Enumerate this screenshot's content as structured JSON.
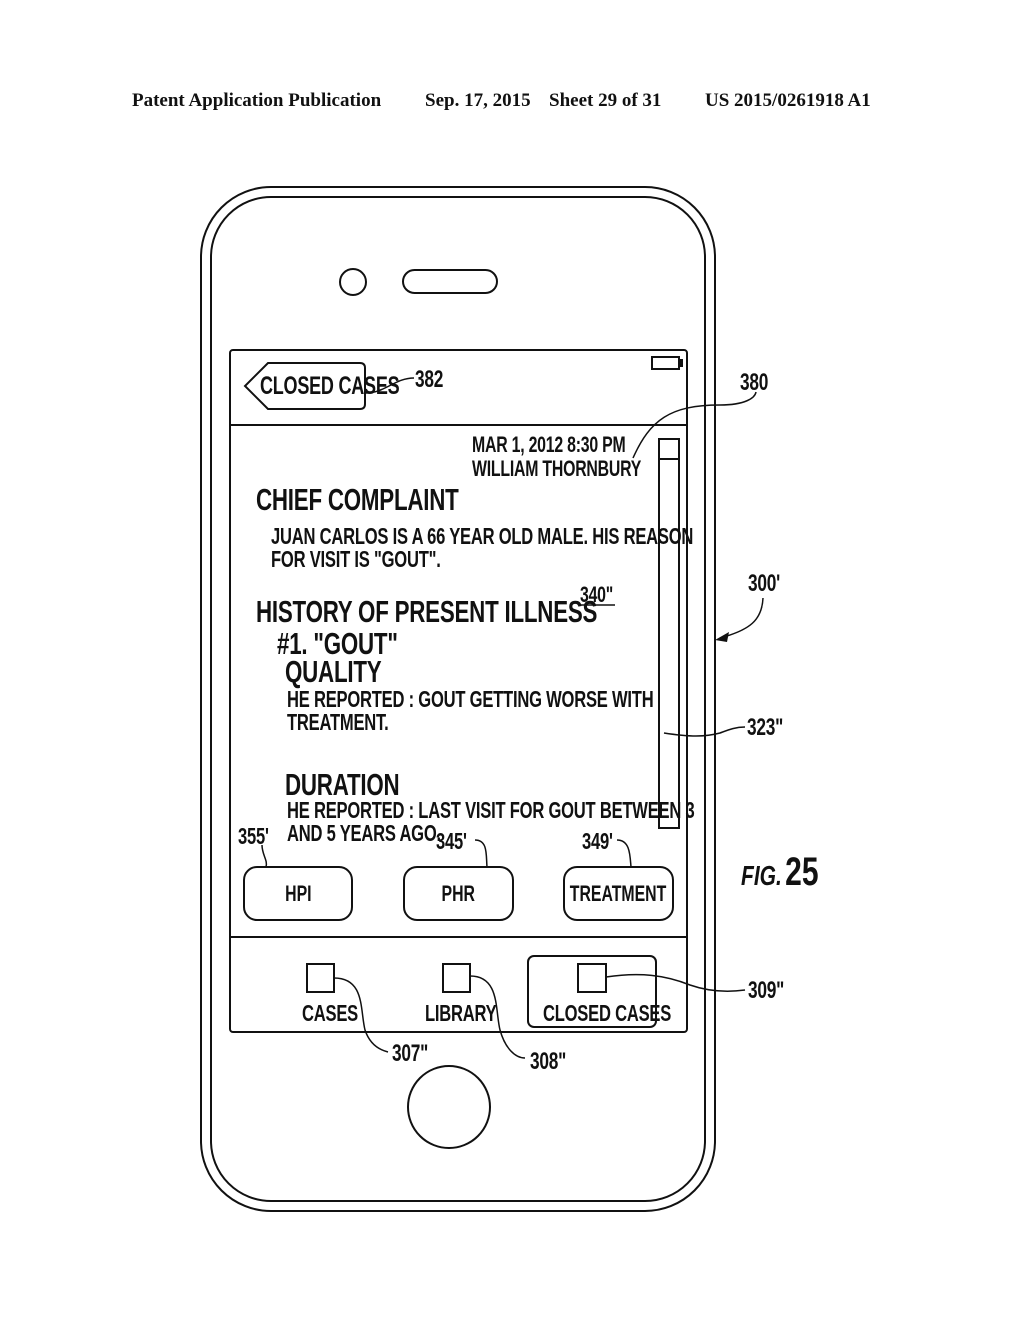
{
  "header": {
    "publication": "Patent Application Publication",
    "date": "Sep. 17, 2015",
    "sheet": "Sheet 29 of 31",
    "number": "US 2015/0261918 A1"
  },
  "figure_label": "FIG. 25",
  "figure_label_prefix": "FIG.",
  "figure_label_number": "25",
  "screen": {
    "back_button_label": "CLOSED CASES",
    "battery_icon": "battery-icon",
    "timestamp": "MAR 1, 2012 8:30 PM",
    "physician": "WILLIAM THORNBURY",
    "sections": {
      "chief_complaint_title": "CHIEF COMPLAINT",
      "chief_complaint_line1": "JUAN CARLOS IS A 66 YEAR OLD MALE. HIS REASON",
      "chief_complaint_line2": "FOR VISIT IS \"GOUT\".",
      "hpi_title": "HISTORY OF PRESENT ILLNESS",
      "hpi_item": "#1.  \"GOUT\"",
      "quality_title": "QUALITY",
      "quality_line1": "HE REPORTED : GOUT GETTING WORSE WITH",
      "quality_line2": "TREATMENT.",
      "duration_title": "DURATION",
      "duration_line1": "HE REPORTED : LAST VISIT FOR GOUT BETWEEN 3",
      "duration_line2": "AND 5 YEARS AGO."
    },
    "action_buttons": [
      {
        "label": "HPI",
        "ref": "355'"
      },
      {
        "label": "PHR",
        "ref": "345'"
      },
      {
        "label": "TREATMENT",
        "ref": "349'"
      }
    ],
    "tab_bar": [
      {
        "label": "CASES",
        "ref": "307\"",
        "selected": false
      },
      {
        "label": "LIBRARY",
        "ref": "308\"",
        "selected": false
      },
      {
        "label": "CLOSED CASES",
        "ref": "309\"",
        "selected": true
      }
    ]
  },
  "reference_numerals": {
    "back_button": "382",
    "status_area": "380",
    "content_area": "340\"",
    "device": "300'",
    "scrollbar": "323\""
  }
}
